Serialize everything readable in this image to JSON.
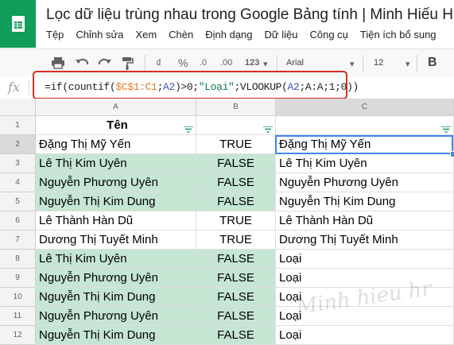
{
  "app": {
    "title": "Lọc dữ liệu trùng nhau trong Google Bảng tính | Minh Hiếu HR",
    "brand_color": "#0f9d58"
  },
  "menu": {
    "items": [
      "Tệp",
      "Chỉnh sửa",
      "Xem",
      "Chèn",
      "Định dạng",
      "Dữ liệu",
      "Công cụ",
      "Tiện ích bổ sung"
    ]
  },
  "toolbar": {
    "currency": "₫",
    "percent": "%",
    "decrease_decimals": ".0",
    "increase_decimals": ".00",
    "more_formats": "123",
    "font": "Arial",
    "font_size": "12",
    "bold": "B",
    "icons": [
      "print-icon",
      "undo-icon",
      "redo-icon",
      "paint-format-icon",
      "bold-icon"
    ]
  },
  "formula_bar": {
    "fx_label": "fx",
    "formula_parts": {
      "p1": "=if(countif(",
      "r1": "$C$1:C1",
      "p2": ";",
      "r2": "A2",
      "p3": ")>0;",
      "s1": "\"Loại\"",
      "p4": ";VLOOKUP(",
      "r3": "A2",
      "p5": ";A:A;1;0))"
    },
    "highlight_color": "#d93025"
  },
  "columns": [
    {
      "label": "A"
    },
    {
      "label": "B"
    },
    {
      "label": "C"
    }
  ],
  "header_row": {
    "row_number": "1",
    "a": "Tên",
    "b": "",
    "c": ""
  },
  "rows": [
    {
      "n": "2",
      "a": "Đặng Thị Mỹ Yến",
      "b": "TRUE",
      "c": "Đặng Thị Mỹ Yến"
    },
    {
      "n": "3",
      "a": "Lê Thị Kim Uyên",
      "b": "FALSE",
      "c": "Lê Thị Kim Uyên"
    },
    {
      "n": "4",
      "a": "Nguyễn Phương Uyên",
      "b": "FALSE",
      "c": "Nguyễn Phương Uyên"
    },
    {
      "n": "5",
      "a": "Nguyễn Thị Kim Dung",
      "b": "FALSE",
      "c": "Nguyễn Thị Kim Dung"
    },
    {
      "n": "6",
      "a": "Lê Thành Hàn Dũ",
      "b": "TRUE",
      "c": "Lê Thành Hàn Dũ"
    },
    {
      "n": "7",
      "a": "Dương Thị Tuyết Minh",
      "b": "TRUE",
      "c": "Dương Thị Tuyết Minh"
    },
    {
      "n": "8",
      "a": "Lê Thị Kim Uyên",
      "b": "FALSE",
      "c": "Loại"
    },
    {
      "n": "9",
      "a": "Nguyễn Phương Uyên",
      "b": "FALSE",
      "c": "Loại"
    },
    {
      "n": "10",
      "a": "Nguyễn Thị Kim Dung",
      "b": "FALSE",
      "c": "Loại"
    },
    {
      "n": "11",
      "a": "Nguyễn Phương Uyên",
      "b": "FALSE",
      "c": "Loại"
    },
    {
      "n": "12",
      "a": "Nguyễn Thị Kim Dung",
      "b": "FALSE",
      "c": "Loại"
    }
  ],
  "highlight_color": "#c5e6d3",
  "watermark": "Minh hieu hr"
}
